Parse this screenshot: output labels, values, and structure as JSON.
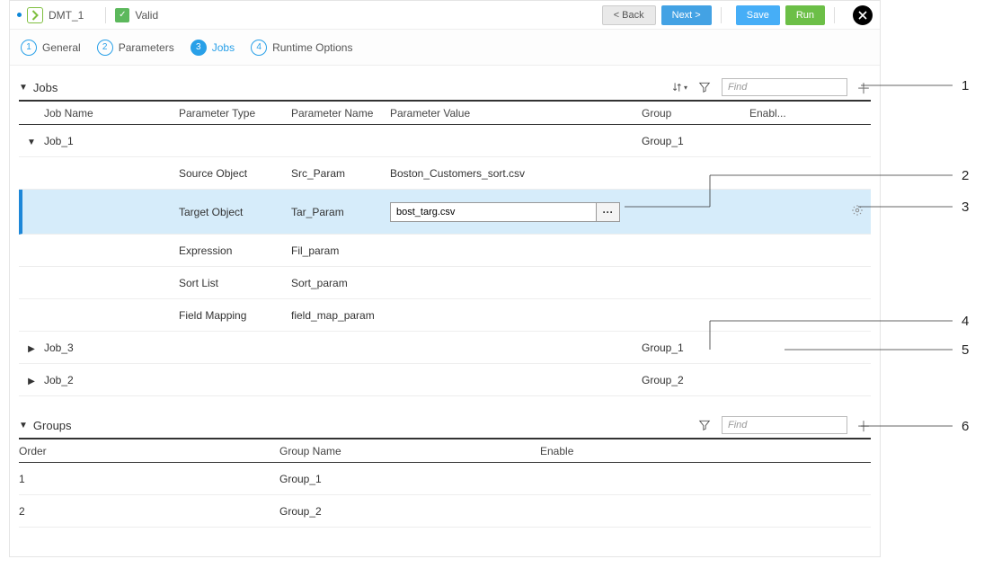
{
  "topbar": {
    "task_name": "DMT_1",
    "valid_label": "Valid",
    "back_label": "< Back",
    "next_label": "Next >",
    "save_label": "Save",
    "run_label": "Run"
  },
  "wizard": {
    "steps": [
      {
        "num": "1",
        "label": "General"
      },
      {
        "num": "2",
        "label": "Parameters"
      },
      {
        "num": "3",
        "label": "Jobs"
      },
      {
        "num": "4",
        "label": "Runtime Options"
      }
    ],
    "active_index": 2
  },
  "jobs_section": {
    "title": "Jobs",
    "find_placeholder": "Find",
    "columns": {
      "job_name": "Job Name",
      "ptype": "Parameter Type",
      "pname": "Parameter Name",
      "pval": "Parameter Value",
      "group": "Group",
      "enable": "Enabl..."
    },
    "job1": {
      "name": "Job_1",
      "group": "Group_1",
      "params": {
        "p1_type": "Source Object",
        "p1_name": "Src_Param",
        "p1_val": "Boston_Customers_sort.csv",
        "p2_type": "Target Object",
        "p2_name": "Tar_Param",
        "p2_val": "bost_targ.csv",
        "p3_type": "Expression",
        "p3_name": "Fil_param",
        "p4_type": "Sort List",
        "p4_name": "Sort_param",
        "p5_type": "Field Mapping",
        "p5_name": "field_map_param"
      }
    },
    "job3": {
      "name": "Job_3",
      "group": "Group_1"
    },
    "job2": {
      "name": "Job_2",
      "group": "Group_2"
    }
  },
  "groups_section": {
    "title": "Groups",
    "find_placeholder": "Find",
    "columns": {
      "order": "Order",
      "name": "Group Name",
      "enable": "Enable"
    },
    "rows": [
      {
        "order": "1",
        "name": "Group_1"
      },
      {
        "order": "2",
        "name": "Group_2"
      }
    ]
  },
  "callouts": {
    "c1": "1",
    "c2": "2",
    "c3": "3",
    "c4": "4",
    "c5": "5",
    "c6": "6"
  }
}
